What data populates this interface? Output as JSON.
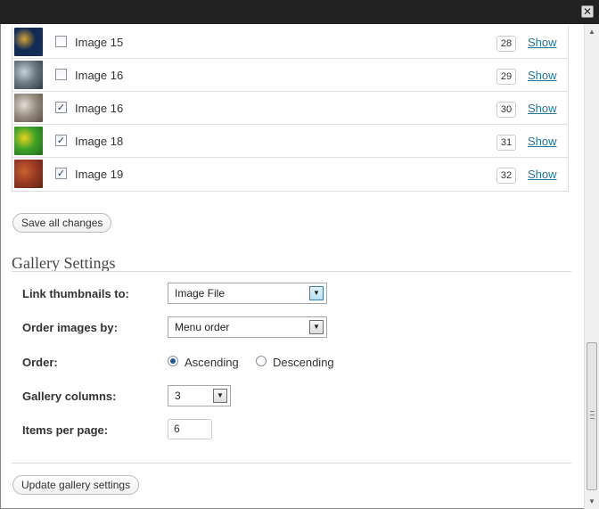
{
  "window": {
    "close_glyph": "✕"
  },
  "media_items": [
    {
      "title": "Image 15",
      "order": "28",
      "checked": false,
      "show_label": "Show",
      "thumb_colors": [
        "#0f2a55",
        "#d8a135",
        "#1b2f52"
      ]
    },
    {
      "title": "Image 16",
      "order": "29",
      "checked": false,
      "show_label": "Show",
      "thumb_colors": [
        "#6d7b86",
        "#c9d2d8",
        "#2e3a44"
      ]
    },
    {
      "title": "Image 16",
      "order": "30",
      "checked": true,
      "show_label": "Show",
      "thumb_colors": [
        "#9a8f84",
        "#e2ddd6",
        "#5b4f44"
      ]
    },
    {
      "title": "Image 18",
      "order": "31",
      "checked": true,
      "show_label": "Show",
      "thumb_colors": [
        "#3fa32a",
        "#e9d21b",
        "#1f6e18"
      ]
    },
    {
      "title": "Image 19",
      "order": "32",
      "checked": true,
      "show_label": "Show",
      "thumb_colors": [
        "#9b3b24",
        "#c8622f",
        "#5e2314"
      ]
    }
  ],
  "buttons": {
    "save_all": "Save all changes",
    "update_gallery": "Update gallery settings"
  },
  "gallery_settings": {
    "title": "Gallery Settings",
    "link_label": "Link thumbnails to:",
    "link_value": "Image File",
    "order_by_label": "Order images by:",
    "order_by_value": "Menu order",
    "order_label": "Order:",
    "ascending_label": "Ascending",
    "descending_label": "Descending",
    "order_selected": "Ascending",
    "columns_label": "Gallery columns:",
    "columns_value": "3",
    "items_label": "Items per page:",
    "items_value": "6"
  },
  "colors": {
    "link": "#21759b",
    "titlebar": "#222222"
  }
}
